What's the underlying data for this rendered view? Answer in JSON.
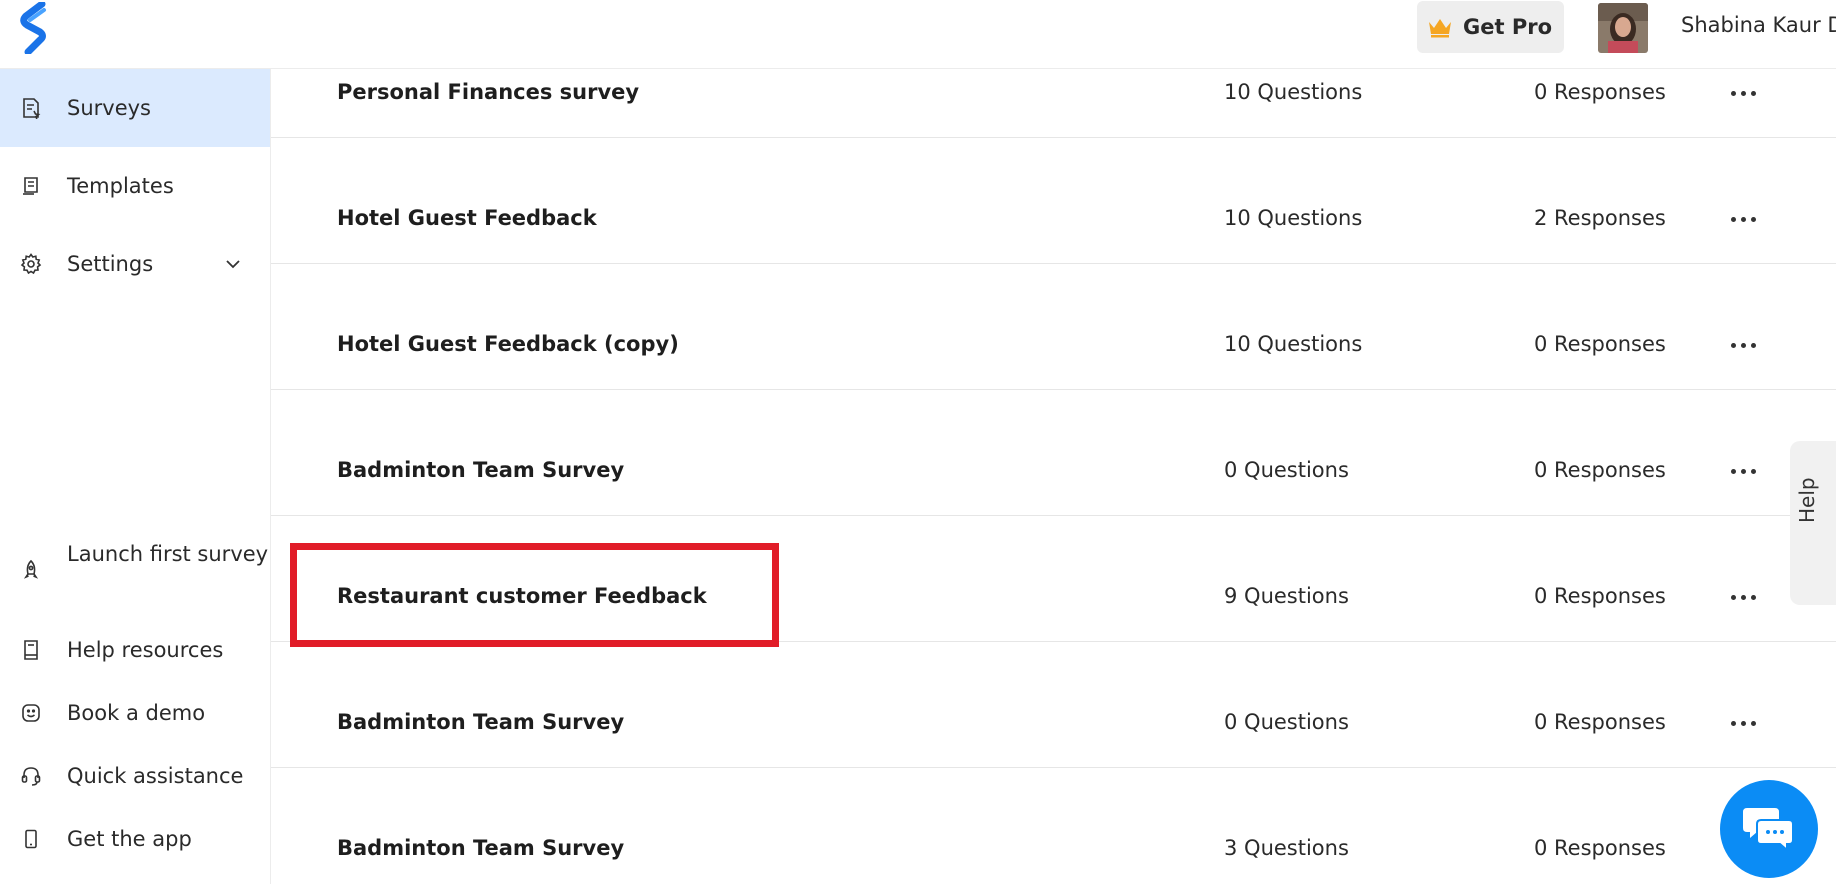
{
  "app": {
    "brand_color": "#1a73e8"
  },
  "header": {
    "get_pro_label": "Get Pro",
    "user_name": "Shabina Kaur D",
    "crown_color": "#f5a623"
  },
  "sidebar": {
    "items": [
      {
        "label": "Surveys",
        "icon": "surveys-icon",
        "active": true
      },
      {
        "label": "Templates",
        "icon": "templates-icon",
        "active": false
      },
      {
        "label": "Settings",
        "icon": "gear-icon",
        "active": false
      }
    ],
    "bottom_items": [
      {
        "label": "Launch first survey",
        "icon": "rocket-icon"
      },
      {
        "label": "Help resources",
        "icon": "book-icon"
      },
      {
        "label": "Book a demo",
        "icon": "smile-icon"
      },
      {
        "label": "Quick assistance",
        "icon": "headset-icon"
      },
      {
        "label": "Get the app",
        "icon": "phone-icon"
      }
    ]
  },
  "surveys": [
    {
      "name": "Personal Finances survey",
      "questions": "10 Questions",
      "responses": "0 Responses"
    },
    {
      "name": "Hotel Guest Feedback",
      "questions": "10 Questions",
      "responses": "2 Responses"
    },
    {
      "name": "Hotel Guest Feedback (copy)",
      "questions": "10 Questions",
      "responses": "0 Responses"
    },
    {
      "name": "Badminton Team Survey",
      "questions": "0 Questions",
      "responses": "0 Responses"
    },
    {
      "name": "Restaurant customer Feedback",
      "questions": "9 Questions",
      "responses": "0 Responses"
    },
    {
      "name": "Badminton Team Survey",
      "questions": "0 Questions",
      "responses": "0 Responses"
    },
    {
      "name": "Badminton Team Survey",
      "questions": "3 Questions",
      "responses": "0 Responses"
    }
  ],
  "help_tab": {
    "label": "Help"
  },
  "highlight_color": "#e11d28",
  "chat_color": "#0b8cf5"
}
